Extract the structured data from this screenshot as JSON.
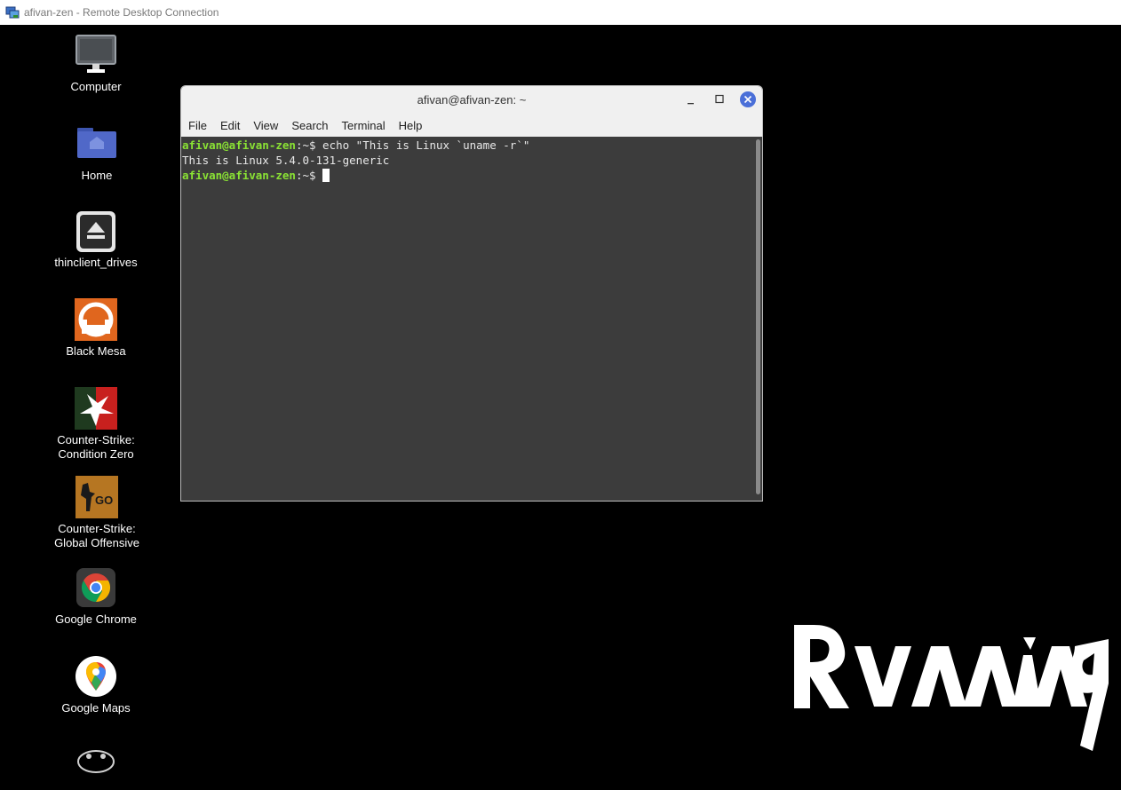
{
  "rdp": {
    "title": "afivan-zen - Remote Desktop Connection"
  },
  "desktop": {
    "icons": [
      {
        "label": "Computer",
        "icon": "computer-icon"
      },
      {
        "label": "Home",
        "icon": "home-folder-icon"
      },
      {
        "label": "thinclient_drives",
        "icon": "eject-drive-icon"
      },
      {
        "label": "Black Mesa",
        "icon": "black-mesa-icon"
      },
      {
        "label": "Counter-Strike: Condition Zero",
        "icon": "cs-condition-zero-icon"
      },
      {
        "label": "Counter-Strike: Global Offensive",
        "icon": "csgo-icon"
      },
      {
        "label": "Google Chrome",
        "icon": "chrome-icon"
      },
      {
        "label": "Google Maps",
        "icon": "google-maps-icon"
      }
    ]
  },
  "terminal": {
    "title": "afivan@afivan-zen: ~",
    "menu": [
      "File",
      "Edit",
      "View",
      "Search",
      "Terminal",
      "Help"
    ],
    "lines": [
      {
        "prompt": "afivan@afivan-zen",
        "cwd": ":~$ ",
        "text": "echo \"This is Linux `uname -r`\""
      },
      {
        "output": "This is Linux 5.4.0-131-generic"
      },
      {
        "prompt": "afivan@afivan-zen",
        "cwd": ":~$ ",
        "text": ""
      }
    ]
  },
  "wallpaper": {
    "logo_text": "Running"
  },
  "colors": {
    "prompt": "#8ae234",
    "terminal_bg": "#3c3c3c",
    "close_button": "#4a6fd8",
    "desktop_bg": "#000000"
  }
}
